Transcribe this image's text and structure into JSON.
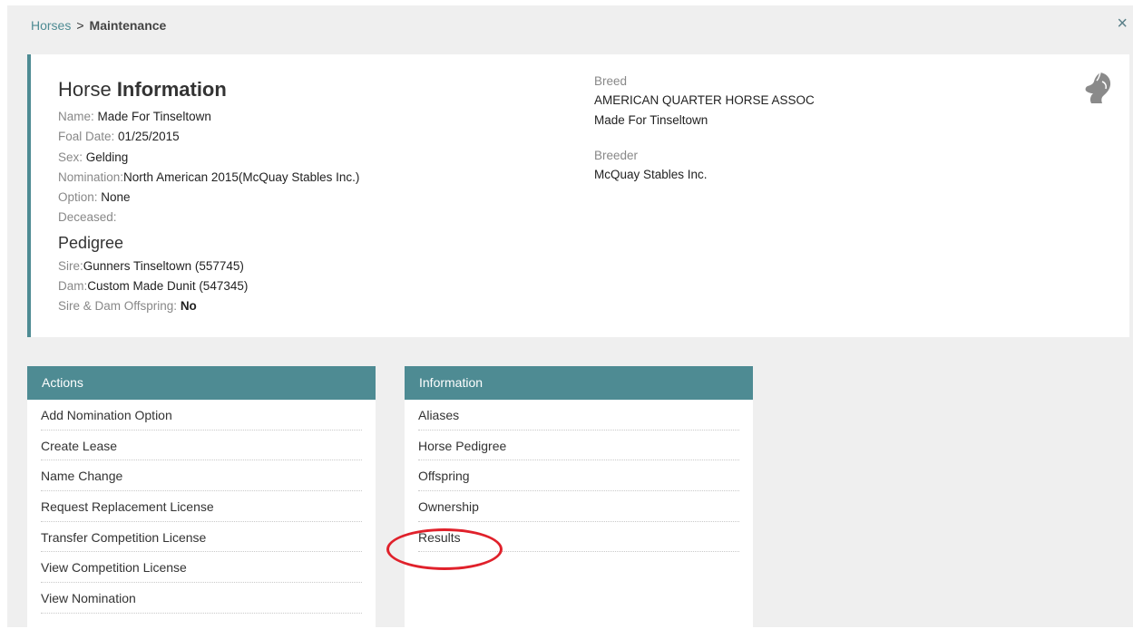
{
  "breadcrumb": {
    "parent": "Horses",
    "separator": ">",
    "current": "Maintenance"
  },
  "close_label": "×",
  "horse_info": {
    "title_light": "Horse",
    "title_bold": "Information",
    "fields": [
      {
        "label": "Name:",
        "value": "Made For Tinseltown"
      },
      {
        "label": "Foal Date:",
        "value": "01/25/2015"
      },
      {
        "label": "Sex:",
        "value": "Gelding"
      },
      {
        "label": "Nomination:",
        "value": "North American 2015(McQuay Stables Inc.)"
      },
      {
        "label": "Option:",
        "value": "None"
      },
      {
        "label": "Deceased:",
        "value": ""
      }
    ],
    "pedigree_heading": "Pedigree",
    "pedigree": [
      {
        "label": "Sire:",
        "value": "Gunners Tinseltown (557745)"
      },
      {
        "label": "Dam:",
        "value": "Custom Made Dunit (547345)"
      },
      {
        "label": "Sire & Dam Offspring:",
        "value": "No"
      }
    ],
    "breed_label": "Breed",
    "breed_lines": [
      "AMERICAN QUARTER HORSE ASSOC",
      "Made For Tinseltown"
    ],
    "breeder_label": "Breeder",
    "breeder_value": "McQuay Stables Inc.",
    "icon": "horse-head-icon"
  },
  "actions_panel": {
    "title": "Actions",
    "items": [
      "Add Nomination Option",
      "Create Lease",
      "Name Change",
      "Request Replacement License",
      "Transfer Competition License",
      "View Competition License",
      "View Nomination"
    ]
  },
  "information_panel": {
    "title": "Information",
    "items": [
      "Aliases",
      "Horse Pedigree",
      "Offspring",
      "Ownership",
      "Results"
    ]
  },
  "colors": {
    "accent": "#4e8b93",
    "highlight": "#e0212b",
    "background": "#efefef"
  }
}
